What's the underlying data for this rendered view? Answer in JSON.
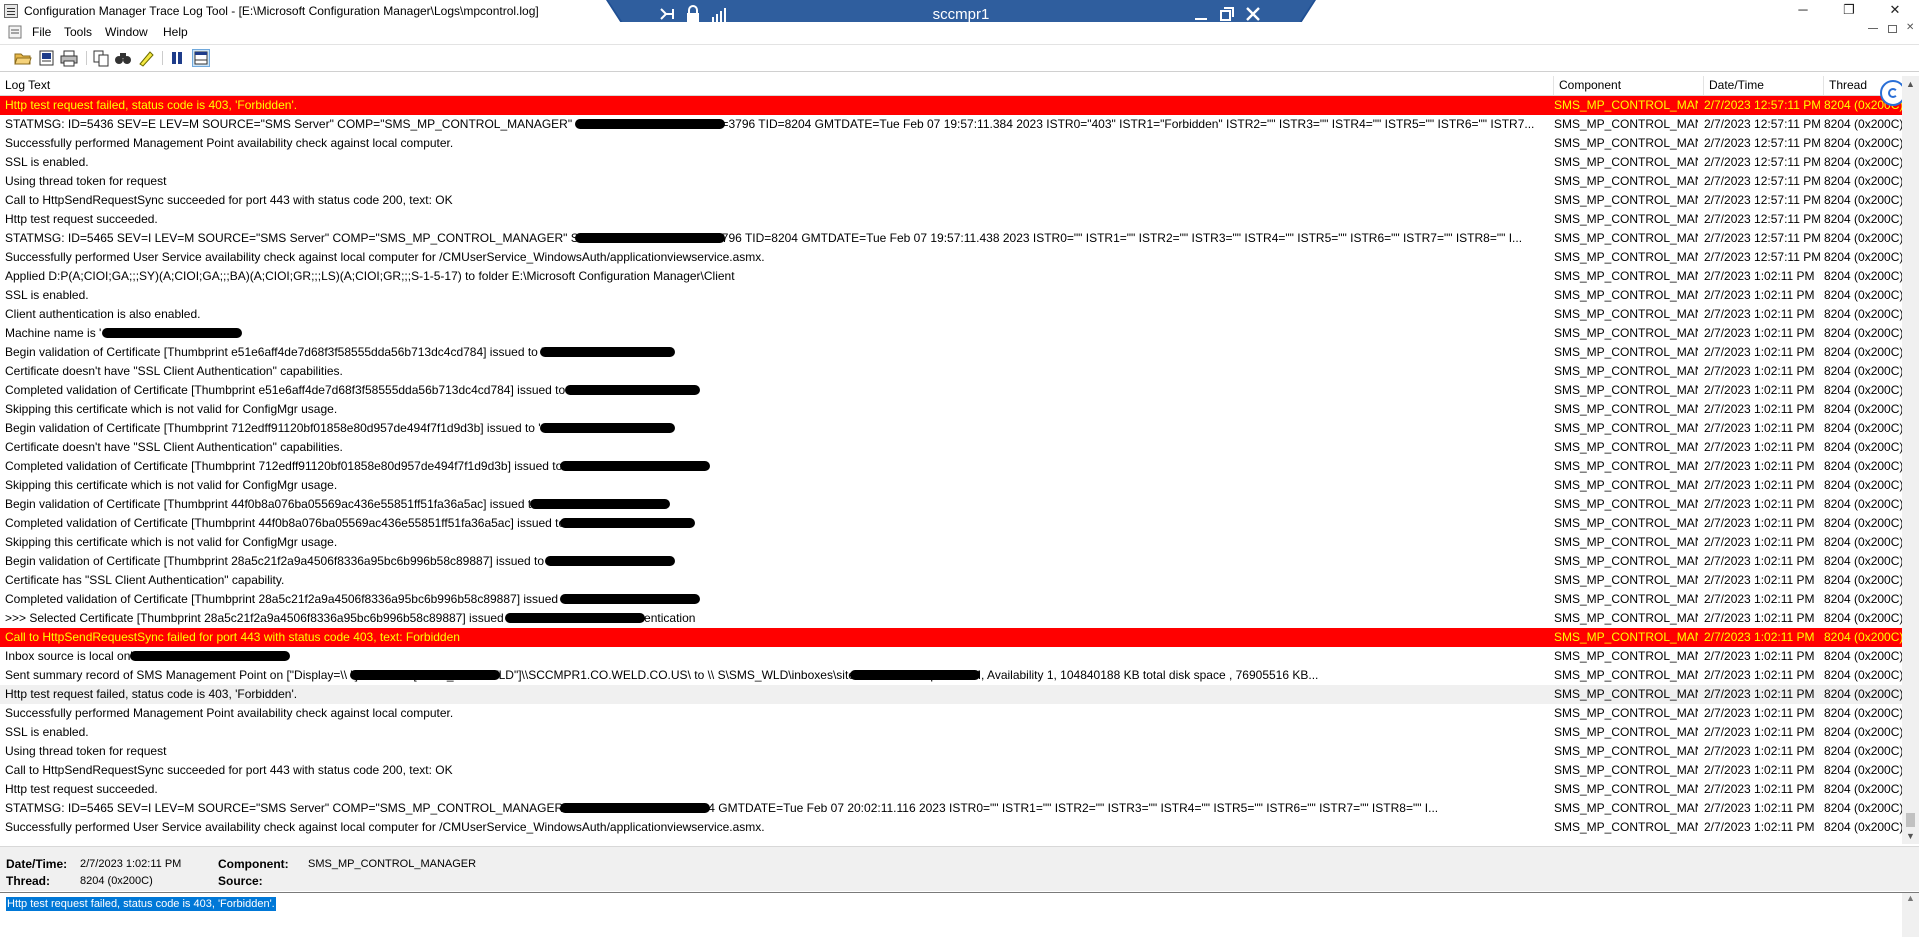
{
  "window": {
    "title": "Configuration Manager Trace Log Tool - [E:\\Microsoft Configuration Manager\\Logs\\mpcontrol.log]",
    "minimize": "─",
    "maximize": "❐",
    "close": "✕"
  },
  "remote_bar": {
    "name": "sccmpr1"
  },
  "menu": [
    "File",
    "Tools",
    "Window",
    "Help"
  ],
  "toolbar_icons": [
    "open-icon",
    "print-preview-icon",
    "print-icon",
    "copy-icon",
    "find-icon",
    "highlight-icon",
    "pause-icon",
    "details-pane-icon"
  ],
  "columns": {
    "text": "Log Text",
    "component": "Component",
    "datetime": "Date/Time",
    "thread": "Thread"
  },
  "colors": {
    "error_bg": "#ff0000",
    "error_fg": "#ffff00",
    "warning_bg": "#f0f0f0",
    "selection": "#0078d7",
    "rd_bar": "#2f5e9e"
  },
  "log_rows": [
    {
      "text": "Http test request failed, status code is 403, 'Forbidden'.",
      "component": "SMS_MP_CONTROL_MANAGER",
      "datetime": "2/7/2023 12:57:11 PM",
      "thread": "8204 (0x200C)",
      "level": "error"
    },
    {
      "text": "STATMSG: ID=5436 SEV=E LEV=M SOURCE=\"SMS Server\" COMP=\"SMS_MP_CONTROL_MANAGER\" SYS=S                                          US SITE=WLD PID=3796 TID=8204 GMTDATE=Tue Feb 07 19:57:11.384 2023 ISTR0=\"403\" ISTR1=\"Forbidden\" ISTR2=\"\" ISTR3=\"\" ISTR4=\"\" ISTR5=\"\" ISTR6=\"\" ISTR7...",
      "component": "SMS_MP_CONTROL_MANAGER",
      "datetime": "2/7/2023 12:57:11 PM",
      "thread": "8204 (0x200C)",
      "level": "info"
    },
    {
      "text": "Successfully performed Management Point availability check against local computer.",
      "component": "SMS_MP_CONTROL_MANAGER",
      "datetime": "2/7/2023 12:57:11 PM",
      "thread": "8204 (0x200C)",
      "level": "info"
    },
    {
      "text": "SSL is enabled.",
      "component": "SMS_MP_CONTROL_MANAGER",
      "datetime": "2/7/2023 12:57:11 PM",
      "thread": "8204 (0x200C)",
      "level": "info"
    },
    {
      "text": "Using thread token for request",
      "component": "SMS_MP_CONTROL_MANAGER",
      "datetime": "2/7/2023 12:57:11 PM",
      "thread": "8204 (0x200C)",
      "level": "info"
    },
    {
      "text": "Call to HttpSendRequestSync succeeded for port 443 with status code 200, text: OK",
      "component": "SMS_MP_CONTROL_MANAGER",
      "datetime": "2/7/2023 12:57:11 PM",
      "thread": "8204 (0x200C)",
      "level": "info"
    },
    {
      "text": "Http test request succeeded.",
      "component": "SMS_MP_CONTROL_MANAGER",
      "datetime": "2/7/2023 12:57:11 PM",
      "thread": "8204 (0x200C)",
      "level": "info"
    },
    {
      "text": "STATMSG: ID=5465 SEV=I LEV=M SOURCE=\"SMS Server\" COMP=\"SMS_MP_CONTROL_MANAGER\" SYS=S                                           S SITE=WLD PID=3796 TID=8204 GMTDATE=Tue Feb 07 19:57:11.438 2023 ISTR0=\"\" ISTR1=\"\" ISTR2=\"\" ISTR3=\"\" ISTR4=\"\" ISTR5=\"\" ISTR6=\"\" ISTR7=\"\" ISTR8=\"\" I...",
      "component": "SMS_MP_CONTROL_MANAGER",
      "datetime": "2/7/2023 12:57:11 PM",
      "thread": "8204 (0x200C)",
      "level": "info"
    },
    {
      "text": "Successfully performed User Service availability check against local computer for /CMUserService_WindowsAuth/applicationviewservice.asmx.",
      "component": "SMS_MP_CONTROL_MANAGER",
      "datetime": "2/7/2023 12:57:11 PM",
      "thread": "8204 (0x200C)",
      "level": "info"
    },
    {
      "text": "Applied D:P(A;CIOI;GA;;;SY)(A;CIOI;GA;;;BA)(A;CIOI;GR;;;LS)(A;CIOI;GR;;;S-1-5-17) to folder E:\\Microsoft Configuration Manager\\Client",
      "component": "SMS_MP_CONTROL_MANAGER",
      "datetime": "2/7/2023 1:02:11 PM",
      "thread": "8204 (0x200C)",
      "level": "info"
    },
    {
      "text": "SSL is enabled.",
      "component": "SMS_MP_CONTROL_MANAGER",
      "datetime": "2/7/2023 1:02:11 PM",
      "thread": "8204 (0x200C)",
      "level": "info"
    },
    {
      "text": "Client authentication is also enabled.",
      "component": "SMS_MP_CONTROL_MANAGER",
      "datetime": "2/7/2023 1:02:11 PM",
      "thread": "8204 (0x200C)",
      "level": "info"
    },
    {
      "text": "Machine name is '                              '.",
      "component": "SMS_MP_CONTROL_MANAGER",
      "datetime": "2/7/2023 1:02:11 PM",
      "thread": "8204 (0x200C)",
      "level": "info"
    },
    {
      "text": "Begin validation of Certificate [Thumbprint e51e6aff4de7d68f3f58555dda56b713dc4cd784] issued to '",
      "component": "SMS_MP_CONTROL_MANAGER",
      "datetime": "2/7/2023 1:02:11 PM",
      "thread": "8204 (0x200C)",
      "level": "info"
    },
    {
      "text": "Certificate doesn't have \"SSL Client Authentication\" capabilities.",
      "component": "SMS_MP_CONTROL_MANAGER",
      "datetime": "2/7/2023 1:02:11 PM",
      "thread": "8204 (0x200C)",
      "level": "info"
    },
    {
      "text": "Completed validation of Certificate [Thumbprint e51e6aff4de7d68f3f58555dda56b713dc4cd784] issued to 's",
      "component": "SMS_MP_CONTROL_MANAGER",
      "datetime": "2/7/2023 1:02:11 PM",
      "thread": "8204 (0x200C)",
      "level": "info"
    },
    {
      "text": "Skipping this certificate which is not valid for ConfigMgr usage.",
      "component": "SMS_MP_CONTROL_MANAGER",
      "datetime": "2/7/2023 1:02:11 PM",
      "thread": "8204 (0x200C)",
      "level": "info"
    },
    {
      "text": "Begin validation of Certificate [Thumbprint 712edff91120bf01858e80d957de494f7f1d9d3b] issued to '",
      "component": "SMS_MP_CONTROL_MANAGER",
      "datetime": "2/7/2023 1:02:11 PM",
      "thread": "8204 (0x200C)",
      "level": "info"
    },
    {
      "text": "Certificate doesn't have \"SSL Client Authentication\" capabilities.",
      "component": "SMS_MP_CONTROL_MANAGER",
      "datetime": "2/7/2023 1:02:11 PM",
      "thread": "8204 (0x200C)",
      "level": "info"
    },
    {
      "text": "Completed validation of Certificate [Thumbprint 712edff91120bf01858e80d957de494f7f1d9d3b] issued to '",
      "component": "SMS_MP_CONTROL_MANAGER",
      "datetime": "2/7/2023 1:02:11 PM",
      "thread": "8204 (0x200C)",
      "level": "info"
    },
    {
      "text": "Skipping this certificate which is not valid for ConfigMgr usage.",
      "component": "SMS_MP_CONTROL_MANAGER",
      "datetime": "2/7/2023 1:02:11 PM",
      "thread": "8204 (0x200C)",
      "level": "info"
    },
    {
      "text": "Begin validation of Certificate [Thumbprint 44f0b8a076ba05569ac436e55851ff51fa36a5ac] issued to '",
      "component": "SMS_MP_CONTROL_MANAGER",
      "datetime": "2/7/2023 1:02:11 PM",
      "thread": "8204 (0x200C)",
      "level": "info"
    },
    {
      "text": "Completed validation of Certificate [Thumbprint 44f0b8a076ba05569ac436e55851ff51fa36a5ac] issued to 's",
      "component": "SMS_MP_CONTROL_MANAGER",
      "datetime": "2/7/2023 1:02:11 PM",
      "thread": "8204 (0x200C)",
      "level": "info"
    },
    {
      "text": "Skipping this certificate which is not valid for ConfigMgr usage.",
      "component": "SMS_MP_CONTROL_MANAGER",
      "datetime": "2/7/2023 1:02:11 PM",
      "thread": "8204 (0x200C)",
      "level": "info"
    },
    {
      "text": "Begin validation of Certificate [Thumbprint 28a5c21f2a9a4506f8336a95bc6b996b58c89887] issued to 's",
      "component": "SMS_MP_CONTROL_MANAGER",
      "datetime": "2/7/2023 1:02:11 PM",
      "thread": "8204 (0x200C)",
      "level": "info"
    },
    {
      "text": "Certificate has \"SSL Client Authentication\" capability.",
      "component": "SMS_MP_CONTROL_MANAGER",
      "datetime": "2/7/2023 1:02:11 PM",
      "thread": "8204 (0x200C)",
      "level": "info"
    },
    {
      "text": "Completed validation of Certificate [Thumbprint 28a5c21f2a9a4506f8336a95bc6b996b58c89887] issued to '",
      "component": "SMS_MP_CONTROL_MANAGER",
      "datetime": "2/7/2023 1:02:11 PM",
      "thread": "8204 (0x200C)",
      "level": "info"
    },
    {
      "text": ">>> Selected Certificate [Thumbprint 28a5c21f2a9a4506f8336a95bc6b996b58c89887] issued to '                                    for HTTPS Client Authentication",
      "component": "SMS_MP_CONTROL_MANAGER",
      "datetime": "2/7/2023 1:02:11 PM",
      "thread": "8204 (0x200C)",
      "level": "info"
    },
    {
      "text": "Call to HttpSendRequestSync failed for port 443 with status code 403, text: Forbidden",
      "component": "SMS_MP_CONTROL_MANAGER",
      "datetime": "2/7/2023 1:02:11 PM",
      "thread": "8204 (0x200C)",
      "level": "error"
    },
    {
      "text": "Inbox source is local on'",
      "component": "SMS_MP_CONTROL_MANAGER",
      "datetime": "2/7/2023 1:02:11 PM",
      "thread": "8204 (0x200C)",
      "level": "info"
    },
    {
      "text": "Sent summary record of SMS Management Point on [\"Display=\\\\                                 \"]MSWNET:[\"SMS_SITE=WLD\"]\\\\SCCMPR1.CO.WELD.CO.US\\ to \\\\                                    S\\SMS_WLD\\inboxes\\sitestat.box\\51zhqlw6.SUM, Availability 1, 104840188 KB total disk space , 76905516 KB...",
      "component": "SMS_MP_CONTROL_MANAGER",
      "datetime": "2/7/2023 1:02:11 PM",
      "thread": "8204 (0x200C)",
      "level": "info"
    },
    {
      "text": "Http test request failed, status code is 403, 'Forbidden'.",
      "component": "SMS_MP_CONTROL_MANAGER",
      "datetime": "2/7/2023 1:02:11 PM",
      "thread": "8204 (0x200C)",
      "level": "warn"
    },
    {
      "text": "Successfully performed Management Point availability check against local computer.",
      "component": "SMS_MP_CONTROL_MANAGER",
      "datetime": "2/7/2023 1:02:11 PM",
      "thread": "8204 (0x200C)",
      "level": "info"
    },
    {
      "text": "SSL is enabled.",
      "component": "SMS_MP_CONTROL_MANAGER",
      "datetime": "2/7/2023 1:02:11 PM",
      "thread": "8204 (0x200C)",
      "level": "info"
    },
    {
      "text": "Using thread token for request",
      "component": "SMS_MP_CONTROL_MANAGER",
      "datetime": "2/7/2023 1:02:11 PM",
      "thread": "8204 (0x200C)",
      "level": "info"
    },
    {
      "text": "Call to HttpSendRequestSync succeeded for port 443 with status code 200, text: OK",
      "component": "SMS_MP_CONTROL_MANAGER",
      "datetime": "2/7/2023 1:02:11 PM",
      "thread": "8204 (0x200C)",
      "level": "info"
    },
    {
      "text": "Http test request succeeded.",
      "component": "SMS_MP_CONTROL_MANAGER",
      "datetime": "2/7/2023 1:02:11 PM",
      "thread": "8204 (0x200C)",
      "level": "info"
    },
    {
      "text": "STATMSG: ID=5465 SEV=I LEV=M SOURCE=\"SMS Server\" COMP=\"SMS_MP_CONTROL_MANAGER\" SYS=                                        PID=3796 TID=8204 GMTDATE=Tue Feb 07 20:02:11.116 2023 ISTR0=\"\" ISTR1=\"\" ISTR2=\"\" ISTR3=\"\" ISTR4=\"\" ISTR5=\"\" ISTR6=\"\" ISTR7=\"\" ISTR8=\"\" I...",
      "component": "SMS_MP_CONTROL_MANAGER",
      "datetime": "2/7/2023 1:02:11 PM",
      "thread": "8204 (0x200C)",
      "level": "info"
    },
    {
      "text": "Successfully performed User Service availability check against local computer for /CMUserService_WindowsAuth/applicationviewservice.asmx.",
      "component": "SMS_MP_CONTROL_MANAGER",
      "datetime": "2/7/2023 1:02:11 PM",
      "thread": "8204 (0x200C)",
      "level": "info"
    }
  ],
  "details": {
    "datetime_label": "Date/Time:",
    "datetime_value": "2/7/2023 1:02:11 PM",
    "component_label": "Component:",
    "component_value": "SMS_MP_CONTROL_MANAGER",
    "thread_label": "Thread:",
    "thread_value": "8204 (0x200C)",
    "source_label": "Source:",
    "source_value": ""
  },
  "message": "Http test request failed, status code is 403, 'Forbidden'."
}
